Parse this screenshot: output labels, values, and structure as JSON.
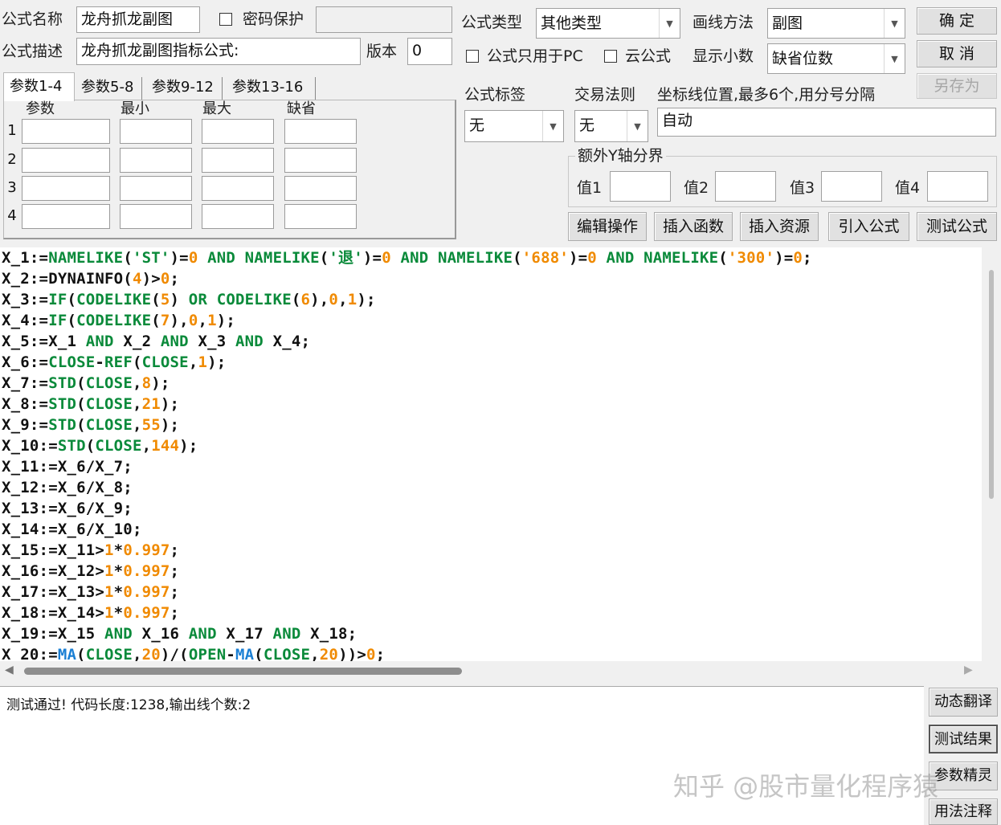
{
  "form": {
    "name_label": "公式名称",
    "name_value": "龙舟抓龙副图",
    "password_label": "密码保护",
    "password_value": "",
    "desc_label": "公式描述",
    "desc_value": "龙舟抓龙副图指标公式:",
    "version_label": "版本",
    "version_value": "0",
    "type_label": "公式类型",
    "type_value": "其他类型",
    "draw_label": "画线方法",
    "draw_value": "副图",
    "pc_only_label": "公式只用于PC",
    "cloud_label": "云公式",
    "decimal_label": "显示小数",
    "decimal_value": "缺省位数",
    "tag_label": "公式标签",
    "tag_value": "无",
    "trade_label": "交易法则",
    "trade_value": "无",
    "axis_label": "坐标线位置,最多6个,用分号分隔",
    "axis_value": "自动",
    "extra_y_label": "额外Y轴分界",
    "val1_label": "值1",
    "val2_label": "值2",
    "val3_label": "值3",
    "val4_label": "值4"
  },
  "buttons": {
    "ok": "确  定",
    "cancel": "取  消",
    "save_as": "另存为",
    "edit_ops": "编辑操作",
    "insert_func": "插入函数",
    "insert_res": "插入资源",
    "import_formula": "引入公式",
    "test_formula": "测试公式",
    "dyn_translate": "动态翻译",
    "test_result": "测试结果",
    "param_wizard": "参数精灵",
    "usage_notes": "用法注释"
  },
  "param_tabs": [
    "参数1-4",
    "参数5-8",
    "参数9-12",
    "参数13-16"
  ],
  "param_headers": [
    "参数",
    "最小",
    "最大",
    "缺省"
  ],
  "param_rows": [
    "1",
    "2",
    "3",
    "4"
  ],
  "code_lines": [
    [
      [
        "X_1:=",
        "p"
      ],
      [
        "NAMELIKE",
        "k"
      ],
      [
        "(",
        "p"
      ],
      [
        "'ST'",
        "s"
      ],
      [
        ")=",
        "p"
      ],
      [
        "0",
        "n"
      ],
      [
        " AND ",
        "k"
      ],
      [
        "NAMELIKE",
        "k"
      ],
      [
        "(",
        "p"
      ],
      [
        "'退'",
        "s"
      ],
      [
        ")=",
        "p"
      ],
      [
        "0",
        "n"
      ],
      [
        " AND ",
        "k"
      ],
      [
        "NAMELIKE",
        "k"
      ],
      [
        "(",
        "p"
      ],
      [
        "'688'",
        "n"
      ],
      [
        ")=",
        "p"
      ],
      [
        "0",
        "n"
      ],
      [
        " AND ",
        "k"
      ],
      [
        "NAMELIKE",
        "k"
      ],
      [
        "(",
        "p"
      ],
      [
        "'300'",
        "n"
      ],
      [
        ")=",
        "p"
      ],
      [
        "0",
        "n"
      ],
      [
        ";",
        "p"
      ]
    ],
    [
      [
        "X_2:=DYNAINFO(",
        "p"
      ],
      [
        "4",
        "n"
      ],
      [
        ")>",
        "p"
      ],
      [
        "0",
        "n"
      ],
      [
        ";",
        "p"
      ]
    ],
    [
      [
        "X_3:=",
        "p"
      ],
      [
        "IF",
        "k"
      ],
      [
        "(",
        "p"
      ],
      [
        "CODELIKE",
        "k"
      ],
      [
        "(",
        "p"
      ],
      [
        "5",
        "n"
      ],
      [
        ")",
        "p"
      ],
      [
        " OR ",
        "k"
      ],
      [
        "CODELIKE",
        "k"
      ],
      [
        "(",
        "p"
      ],
      [
        "6",
        "n"
      ],
      [
        "),",
        "p"
      ],
      [
        "0",
        "n"
      ],
      [
        ",",
        "p"
      ],
      [
        "1",
        "n"
      ],
      [
        ");",
        "p"
      ]
    ],
    [
      [
        "X_4:=",
        "p"
      ],
      [
        "IF",
        "k"
      ],
      [
        "(",
        "p"
      ],
      [
        "CODELIKE",
        "k"
      ],
      [
        "(",
        "p"
      ],
      [
        "7",
        "n"
      ],
      [
        "),",
        "p"
      ],
      [
        "0",
        "n"
      ],
      [
        ",",
        "p"
      ],
      [
        "1",
        "n"
      ],
      [
        ");",
        "p"
      ]
    ],
    [
      [
        "X_5:=X_1",
        "p"
      ],
      [
        " AND ",
        "k"
      ],
      [
        "X_2",
        "p"
      ],
      [
        " AND ",
        "k"
      ],
      [
        "X_3",
        "p"
      ],
      [
        " AND ",
        "k"
      ],
      [
        "X_4;",
        "p"
      ]
    ],
    [
      [
        "X_6:=",
        "p"
      ],
      [
        "CLOSE",
        "k"
      ],
      [
        "-",
        "p"
      ],
      [
        "REF",
        "k"
      ],
      [
        "(",
        "p"
      ],
      [
        "CLOSE",
        "k"
      ],
      [
        ",",
        "p"
      ],
      [
        "1",
        "n"
      ],
      [
        ");",
        "p"
      ]
    ],
    [
      [
        "X_7:=",
        "p"
      ],
      [
        "STD",
        "k"
      ],
      [
        "(",
        "p"
      ],
      [
        "CLOSE",
        "k"
      ],
      [
        ",",
        "p"
      ],
      [
        "8",
        "n"
      ],
      [
        ");",
        "p"
      ]
    ],
    [
      [
        "X_8:=",
        "p"
      ],
      [
        "STD",
        "k"
      ],
      [
        "(",
        "p"
      ],
      [
        "CLOSE",
        "k"
      ],
      [
        ",",
        "p"
      ],
      [
        "21",
        "n"
      ],
      [
        ");",
        "p"
      ]
    ],
    [
      [
        "X_9:=",
        "p"
      ],
      [
        "STD",
        "k"
      ],
      [
        "(",
        "p"
      ],
      [
        "CLOSE",
        "k"
      ],
      [
        ",",
        "p"
      ],
      [
        "55",
        "n"
      ],
      [
        ");",
        "p"
      ]
    ],
    [
      [
        "X_10:=",
        "p"
      ],
      [
        "STD",
        "k"
      ],
      [
        "(",
        "p"
      ],
      [
        "CLOSE",
        "k"
      ],
      [
        ",",
        "p"
      ],
      [
        "144",
        "n"
      ],
      [
        ");",
        "p"
      ]
    ],
    [
      [
        "X_11:=X_6/X_7;",
        "p"
      ]
    ],
    [
      [
        "X_12:=X_6/X_8;",
        "p"
      ]
    ],
    [
      [
        "X_13:=X_6/X_9;",
        "p"
      ]
    ],
    [
      [
        "X_14:=X_6/X_10;",
        "p"
      ]
    ],
    [
      [
        "X_15:=X_11>",
        "p"
      ],
      [
        "1",
        "n"
      ],
      [
        "*",
        "p"
      ],
      [
        "0.997",
        "n"
      ],
      [
        ";",
        "p"
      ]
    ],
    [
      [
        "X_16:=X_12>",
        "p"
      ],
      [
        "1",
        "n"
      ],
      [
        "*",
        "p"
      ],
      [
        "0.997",
        "n"
      ],
      [
        ";",
        "p"
      ]
    ],
    [
      [
        "X_17:=X_13>",
        "p"
      ],
      [
        "1",
        "n"
      ],
      [
        "*",
        "p"
      ],
      [
        "0.997",
        "n"
      ],
      [
        ";",
        "p"
      ]
    ],
    [
      [
        "X_18:=X_14>",
        "p"
      ],
      [
        "1",
        "n"
      ],
      [
        "*",
        "p"
      ],
      [
        "0.997",
        "n"
      ],
      [
        ";",
        "p"
      ]
    ],
    [
      [
        "X_19:=X_15",
        "p"
      ],
      [
        " AND ",
        "k"
      ],
      [
        "X_16",
        "p"
      ],
      [
        " AND ",
        "k"
      ],
      [
        "X_17",
        "p"
      ],
      [
        " AND ",
        "k"
      ],
      [
        "X_18;",
        "p"
      ]
    ],
    [
      [
        "X_20:=",
        "p"
      ],
      [
        "MA",
        "b"
      ],
      [
        "(",
        "p"
      ],
      [
        "CLOSE",
        "k"
      ],
      [
        ",",
        "p"
      ],
      [
        "20",
        "n"
      ],
      [
        ")/(",
        "p"
      ],
      [
        "OPEN",
        "k"
      ],
      [
        "-",
        "p"
      ],
      [
        "MA",
        "b"
      ],
      [
        "(",
        "p"
      ],
      [
        "CLOSE",
        "k"
      ],
      [
        ",",
        "p"
      ],
      [
        "20",
        "n"
      ],
      [
        "))>",
        "p"
      ],
      [
        "0",
        "n"
      ],
      [
        ";",
        "p"
      ]
    ]
  ],
  "output_text": "测试通过! 代码长度:1238,输出线个数:2",
  "watermark": "知乎 @股市量化程序猿",
  "colors": {
    "keyword": "#0a8a3a",
    "number": "#f08a00",
    "blue_func": "#1a7fd4",
    "text": "#111111"
  }
}
